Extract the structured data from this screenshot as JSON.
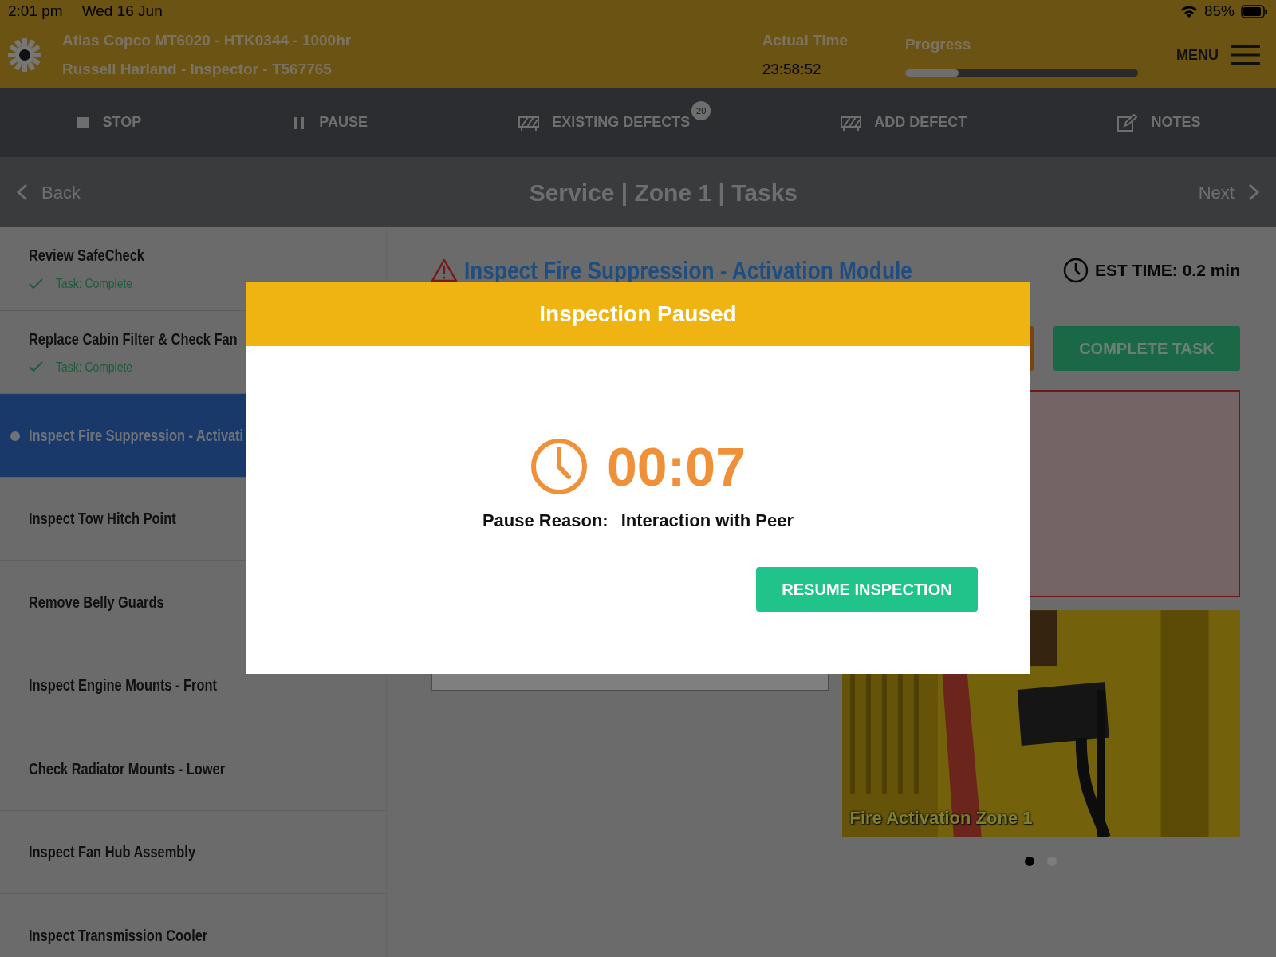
{
  "status_bar": {
    "time": "2:01 pm",
    "date": "Wed 16 Jun",
    "battery": "85%"
  },
  "header": {
    "title": "Atlas Copco MT6020 - HTK0344 - 1000hr",
    "subtitle": "Russell Harland - Inspector - T567765",
    "actual_time_label": "Actual Time",
    "actual_time": "23:58:52",
    "progress_label": "Progress",
    "progress": {
      "level": 0.23
    },
    "menu": "MENU"
  },
  "toolbar": [
    {
      "label": "STOP",
      "kind": "stop"
    },
    {
      "label": "PAUSE",
      "kind": "pause"
    },
    {
      "label": "EXISTING DEFECTS",
      "kind": "defect",
      "badge": "20"
    },
    {
      "label": "ADD DEFECT",
      "kind": "defect"
    },
    {
      "label": "NOTES",
      "kind": "notes"
    }
  ],
  "nav": {
    "back": "Back",
    "title": "Service | Zone 1 | Tasks",
    "next": "Next"
  },
  "tasks": [
    {
      "title": "Review SafeCheck",
      "status": "Task: Complete",
      "selected": false
    },
    {
      "title": "Replace Cabin Filter & Check Fan",
      "status": "Task: Complete",
      "selected": false
    },
    {
      "title": "Inspect Fire Suppression - Activati",
      "selected": true
    },
    {
      "title": "Inspect Tow Hitch Point",
      "selected": false
    },
    {
      "title": "Remove Belly Guards",
      "selected": false
    },
    {
      "title": "Inspect Engine Mounts - Front",
      "selected": false
    },
    {
      "title": "Check Radiator Mounts - Lower",
      "selected": false
    },
    {
      "title": "Inspect Fan Hub Assembly",
      "selected": false
    },
    {
      "title": "Inspect Transmission Cooler",
      "selected": false
    }
  ],
  "task": {
    "title": "Inspect Fire Suppression - Activation Module",
    "est_time": "EST TIME: 0.2 min",
    "complete_button": "COMPLETE TASK",
    "image": {
      "kind": "picture",
      "caption": "Fire Activation Zone 1"
    },
    "carousel": [
      {
        "selected": true
      },
      {
        "selected": false
      }
    ]
  },
  "modal": {
    "title": "Inspection Paused",
    "timer": "00:07",
    "reason_label": "Pause Reason:",
    "reason": "Interaction with Peer",
    "button": "RESUME INSPECTION"
  }
}
